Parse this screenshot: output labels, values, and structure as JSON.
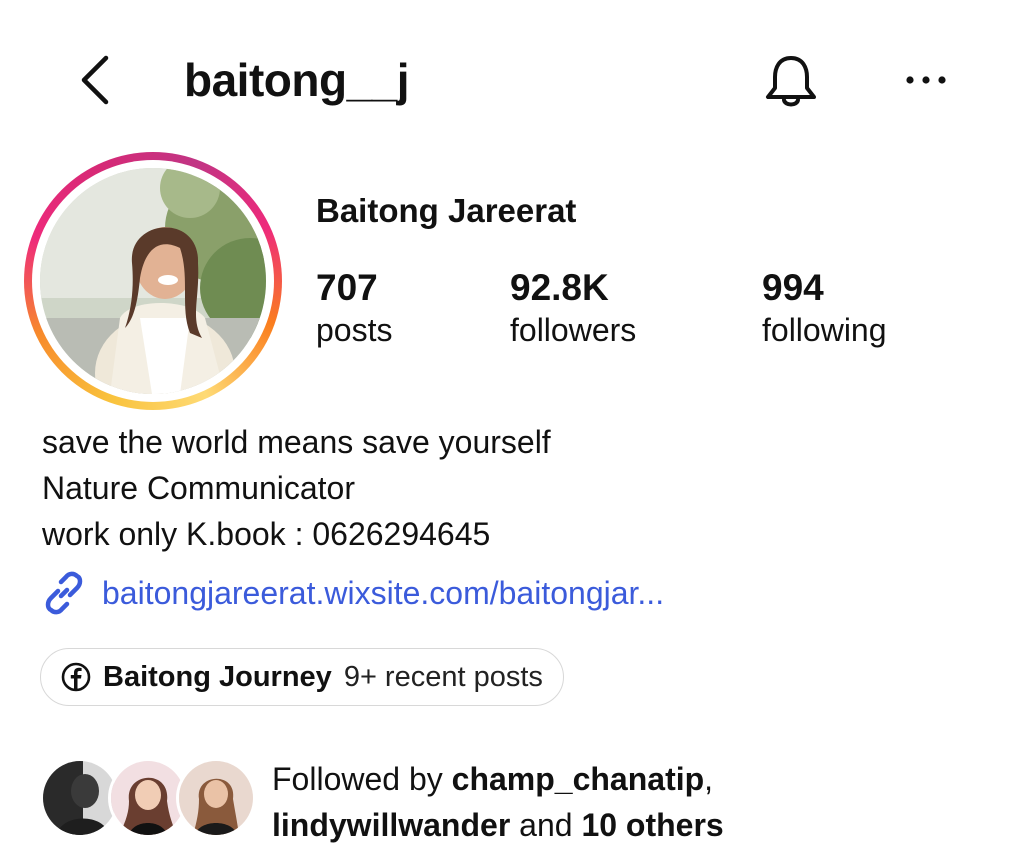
{
  "header": {
    "username": "baitong__j",
    "back_icon": "chevron-left-icon",
    "bell_icon": "bell-icon",
    "more_icon": "more-horizontal-icon"
  },
  "profile": {
    "display_name": "Baitong Jareerat",
    "stats": {
      "posts_count": "707",
      "posts_label": "posts",
      "followers_count": "92.8K",
      "followers_label": "followers",
      "following_count": "994",
      "following_label": "following"
    },
    "bio": [
      "save the world means save yourself",
      "Nature Communicator",
      "work only K.book : 0626294645"
    ],
    "link": "baitongjareerat.wixsite.com/baitongjar...",
    "link_icon": "link-icon"
  },
  "facebook_pill": {
    "icon": "facebook-icon",
    "name": "Baitong Journey",
    "meta": "9+ recent posts"
  },
  "followed_by": {
    "prefix": "Followed by ",
    "user1": "champ_chanatip",
    "sep": ",",
    "user2": "lindywillwander",
    "and": " and ",
    "others": "10 others"
  },
  "colors": {
    "link": "#3b5bdb",
    "ring_pink": "#ee2a7b",
    "ring_yellow": "#f9c23c",
    "border": "#d8d8d8"
  }
}
